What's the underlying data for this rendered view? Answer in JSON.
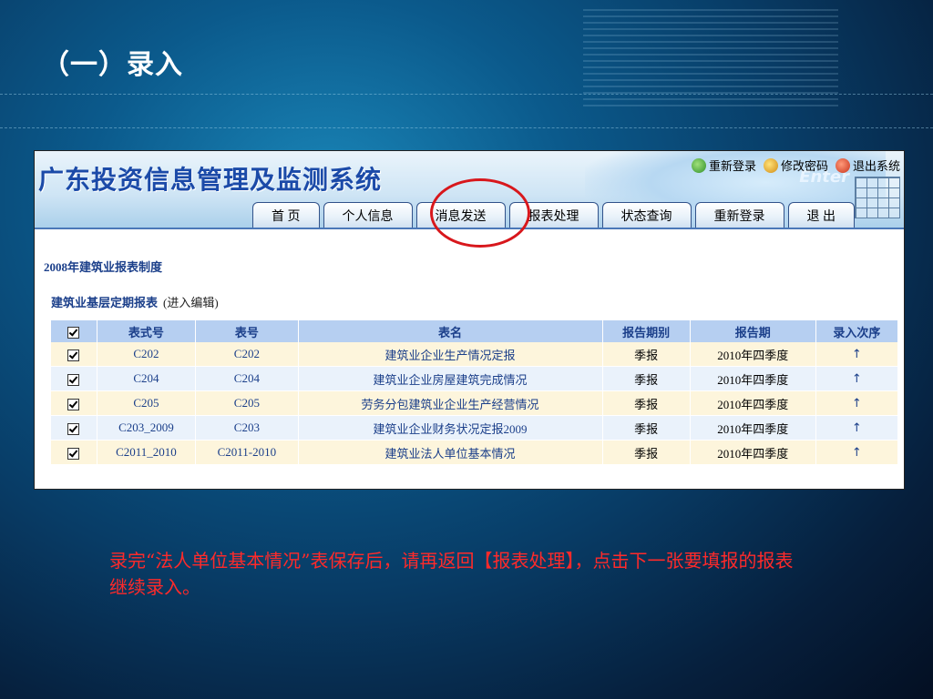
{
  "slide": {
    "title": "（一）录入",
    "instruction": "录完“法人单位基本情况”表保存后，请再返回【报表处理】，点击下一张要填报的报表继续录入。"
  },
  "app": {
    "title": "广东投资信息管理及监测系统",
    "top_links": [
      {
        "label": "重新登录",
        "icon": "refresh-login-icon"
      },
      {
        "label": "修改密码",
        "icon": "change-password-icon"
      },
      {
        "label": "退出系统",
        "icon": "exit-icon"
      }
    ],
    "nav_tabs": [
      {
        "label": "首 页"
      },
      {
        "label": "个人信息"
      },
      {
        "label": "消息发送"
      },
      {
        "label": "报表处理",
        "highlighted": true
      },
      {
        "label": "状态查询"
      },
      {
        "label": "重新登录"
      },
      {
        "label": "退 出"
      }
    ]
  },
  "content": {
    "section_title": "2008年建筑业报表制度",
    "subsection_title": "建筑业基层定期报表",
    "subsection_note": "(进入编辑)",
    "table": {
      "columns": [
        "",
        "表式号",
        "表号",
        "表名",
        "报告期别",
        "报告期",
        "录入次序"
      ],
      "rows": [
        {
          "form": "C202",
          "code": "C202",
          "name": "建筑业企业生产情况定报",
          "period_type": "季报",
          "period": "2010年四季度",
          "order": "↑"
        },
        {
          "form": "C204",
          "code": "C204",
          "name": "建筑业企业房屋建筑完成情况",
          "period_type": "季报",
          "period": "2010年四季度",
          "order": "↑"
        },
        {
          "form": "C205",
          "code": "C205",
          "name": "劳务分包建筑业企业生产经营情况",
          "period_type": "季报",
          "period": "2010年四季度",
          "order": "↑"
        },
        {
          "form": "C203_2009",
          "code": "C203",
          "name": "建筑业企业财务状况定报2009",
          "period_type": "季报",
          "period": "2010年四季度",
          "order": "↑"
        },
        {
          "form": "C2011_2010",
          "code": "C2011-2010",
          "name": "建筑业法人单位基本情况",
          "period_type": "季报",
          "period": "2010年四季度",
          "order": "↑"
        }
      ]
    }
  },
  "colors": {
    "highlight_ring": "#d8171c",
    "instruction_text": "#ff2a2a",
    "header_blue": "#1b4aa8"
  }
}
